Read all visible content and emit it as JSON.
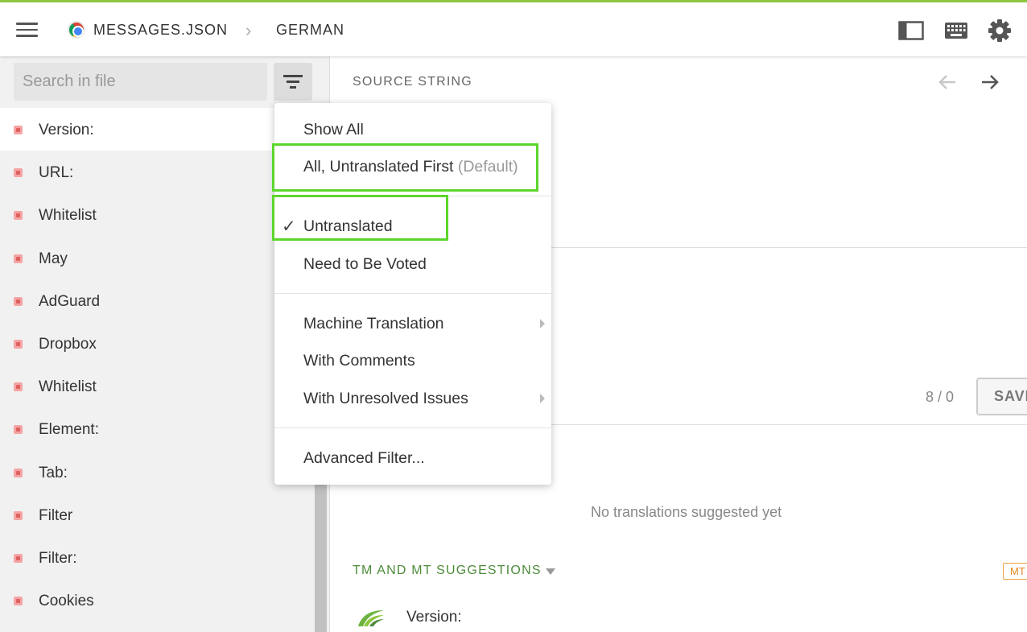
{
  "topbar": {
    "breadcrumb_file": "MESSAGES.JSON",
    "breadcrumb_sep": "›",
    "breadcrumb_language": "GERMAN",
    "accent_color": "#8cc63f"
  },
  "icons": {
    "menu": "hamburger-icon",
    "file": "chrome-icon",
    "sidebar_toggle": "sidebar-layout-icon",
    "keyboard": "keyboard-icon",
    "settings": "gear-icon",
    "filter": "filter-icon",
    "prev": "arrow-left-icon",
    "next": "arrow-right-icon"
  },
  "sidebar": {
    "search_placeholder": "Search in file",
    "items": [
      {
        "label": "Version:"
      },
      {
        "label": "URL:"
      },
      {
        "label": "Whitelist"
      },
      {
        "label": "May"
      },
      {
        "label": "AdGuard"
      },
      {
        "label": "Dropbox"
      },
      {
        "label": "Whitelist"
      },
      {
        "label": "Element:"
      },
      {
        "label": "Tab:"
      },
      {
        "label": "Filter"
      },
      {
        "label": "Filter:"
      },
      {
        "label": "Cookies"
      }
    ]
  },
  "main": {
    "source_label": "SOURCE STRING",
    "counter": "8 / 0",
    "save_label": "SAVE",
    "no_translations": "No translations suggested yet",
    "tm_label": "TM AND MT SUGGESTIONS",
    "mt_badge": "MT",
    "tm_source": "Version:"
  },
  "filter_menu": {
    "show_all": "Show All",
    "untranslated_first": "All, Untranslated First",
    "default_suffix": "(Default)",
    "check_glyph": "✓",
    "untranslated": "Untranslated",
    "need_voted": "Need to Be Voted",
    "machine_translation": "Machine Translation",
    "with_comments": "With Comments",
    "unresolved_issues": "With Unresolved Issues",
    "advanced_filter": "Advanced Filter...",
    "highlight_color": "#5dd62c"
  }
}
